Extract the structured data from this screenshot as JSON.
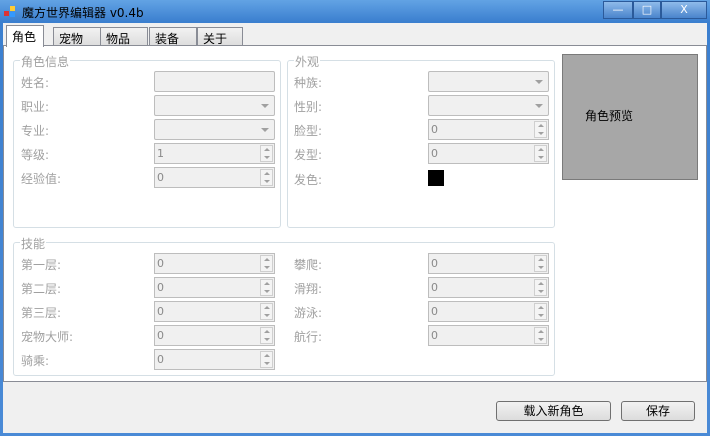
{
  "window": {
    "title": "魔方世界编辑器 v0.4b",
    "minimize": "—",
    "maximize": "□",
    "close": "X"
  },
  "tabs": [
    "角色",
    "宠物",
    "物品",
    "装备",
    "关于"
  ],
  "char_info": {
    "title": "角色信息",
    "fields": [
      {
        "label": "姓名:",
        "type": "text",
        "value": ""
      },
      {
        "label": "职业:",
        "type": "combo",
        "value": ""
      },
      {
        "label": "专业:",
        "type": "combo",
        "value": ""
      },
      {
        "label": "等级:",
        "type": "spin",
        "value": "1"
      },
      {
        "label": "经验值:",
        "type": "spin",
        "value": "0"
      }
    ]
  },
  "appearance": {
    "title": "外观",
    "fields": [
      {
        "label": "种族:",
        "type": "combo",
        "value": ""
      },
      {
        "label": "性别:",
        "type": "combo",
        "value": ""
      },
      {
        "label": "脸型:",
        "type": "spin",
        "value": "0"
      },
      {
        "label": "发型:",
        "type": "spin",
        "value": "0"
      },
      {
        "label": "发色:",
        "type": "color",
        "value": "#000000"
      }
    ]
  },
  "skills": {
    "title": "技能",
    "left": [
      {
        "label": "第一层:",
        "value": "0"
      },
      {
        "label": "第二层:",
        "value": "0"
      },
      {
        "label": "第三层:",
        "value": "0"
      },
      {
        "label": "宠物大师:",
        "value": "0"
      },
      {
        "label": "骑乘:",
        "value": "0"
      }
    ],
    "right": [
      {
        "label": "攀爬:",
        "value": "0"
      },
      {
        "label": "滑翔:",
        "value": "0"
      },
      {
        "label": "游泳:",
        "value": "0"
      },
      {
        "label": "航行:",
        "value": "0"
      }
    ]
  },
  "preview": {
    "label": "角色预览"
  },
  "buttons": {
    "load": "载入新角色",
    "save": "保存"
  }
}
